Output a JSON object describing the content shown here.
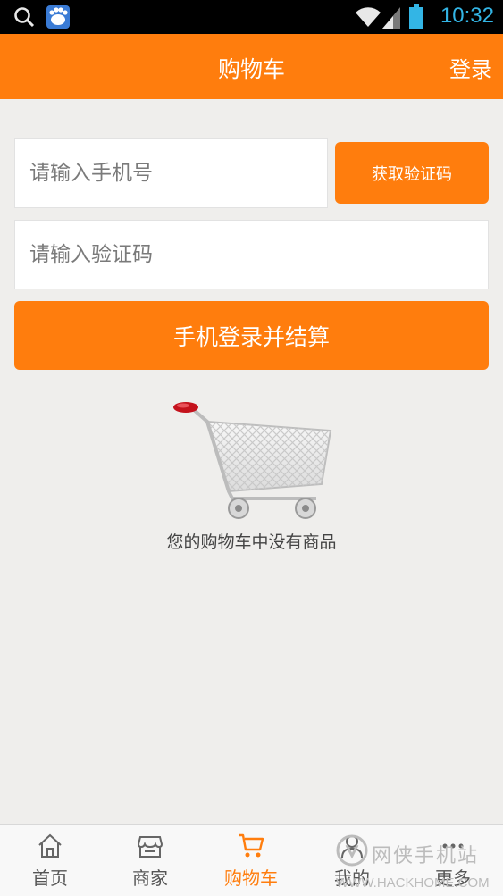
{
  "status_bar": {
    "time": "10:32"
  },
  "header": {
    "title": "购物车",
    "login": "登录"
  },
  "form": {
    "phone_placeholder": "请输入手机号",
    "get_code": "获取验证码",
    "code_placeholder": "请输入验证码",
    "submit": "手机登录并结算"
  },
  "empty": {
    "message": "您的购物车中没有商品"
  },
  "bottom_nav": [
    {
      "label": "首页",
      "icon": "home-icon"
    },
    {
      "label": "商家",
      "icon": "store-icon"
    },
    {
      "label": "购物车",
      "icon": "cart-icon",
      "active": true
    },
    {
      "label": "我的",
      "icon": "user-icon"
    },
    {
      "label": "更多",
      "icon": "more-icon"
    }
  ],
  "watermark": {
    "text": "网侠手机站",
    "sub": "WWW.HACKHOME.COM"
  },
  "colors": {
    "accent": "#ff7d0d",
    "background": "#efeeec",
    "status_time": "#33b5e5"
  }
}
